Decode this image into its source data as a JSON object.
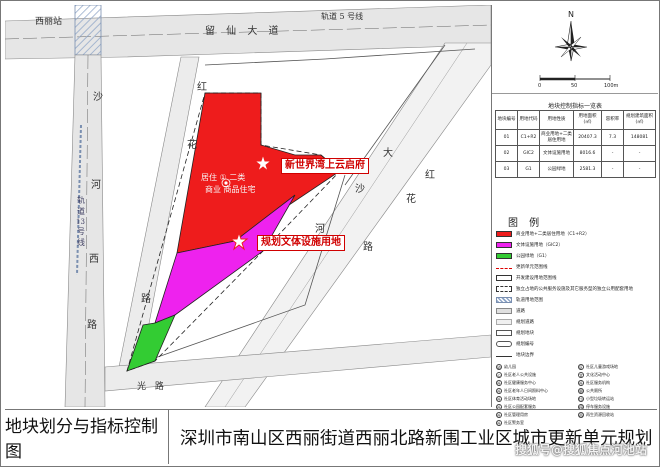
{
  "map": {
    "road_labels": {
      "metro": "轨道 5 号线",
      "liuxian": "留  仙  大  道",
      "xili": "西丽站",
      "honghua": [
        "红",
        "花",
        "路"
      ],
      "shahe": [
        "沙",
        "河",
        "西",
        "路"
      ],
      "metro_v": [
        "轨",
        "道",
        "13",
        "号",
        "线"
      ],
      "dasha_hua": [
        "大",
        "沙",
        "红",
        "花",
        "河",
        "路"
      ],
      "guangming": "光  路"
    },
    "callouts": {
      "hotel": "新世界湾上云启府",
      "culture": "规划文体设施用地"
    },
    "parcel_text": [
      "居住 ①  二类",
      "商业 商品住宅"
    ],
    "colors": {
      "residential": "#ee1c1c",
      "culture": "#ee22ee",
      "park": "#33cc33",
      "road": "#d9d9d9",
      "highlight_star": "#ee1c1c"
    }
  },
  "side": {
    "compass": {
      "north": "N",
      "scale": [
        "0",
        "50",
        "100m"
      ]
    },
    "index_title": "地块控制指标一览表",
    "index_headers": [
      "地块编号",
      "用地代码",
      "用地性质",
      "用地面积(㎡)",
      "容积率",
      "规划建筑面积(㎡)"
    ],
    "index_rows": [
      [
        "01",
        "C1+R2",
        "商业用地+二类居住用地",
        "20407.3",
        "7.3",
        "148081"
      ],
      [
        "02",
        "GIC2",
        "文体设施用地",
        "8016.6",
        "-",
        "-"
      ],
      [
        "03",
        "G1",
        "公园绿地",
        "2581.3",
        "-",
        "-"
      ]
    ],
    "legend_title": "图  例",
    "legend_items": [
      {
        "label": "商业用地+二类居住用地（C1+R2）",
        "color": "#ee1c1c"
      },
      {
        "label": "文体设施用地（GIC2）",
        "color": "#ee22ee"
      },
      {
        "label": "公园绿地（G1）",
        "color": "#33cc33"
      },
      {
        "label": "更新单元范围线",
        "color": ""
      },
      {
        "label": "开发建设用地范围线",
        "color": ""
      },
      {
        "label": "独立占地的公共服务设施及其它服务型的独立公用配套用地",
        "color": ""
      },
      {
        "label": "轨道用地范围",
        "color": ""
      },
      {
        "label": "道路",
        "color": ""
      },
      {
        "label": "规划道路",
        "color": ""
      },
      {
        "label": "规划地块",
        "color": ""
      },
      {
        "label": "规划编号",
        "color": ""
      },
      {
        "label": "地块边界",
        "color": ""
      }
    ],
    "legend_points": [
      {
        "icon": "幼",
        "label": "幼儿园"
      },
      {
        "icon": "区",
        "label": "社区儿童游戏场地"
      },
      {
        "icon": "公",
        "label": "社区老人公共设施"
      },
      {
        "icon": "文",
        "label": "文化活动中心"
      },
      {
        "icon": "社",
        "label": "社区健康服务中心"
      },
      {
        "icon": "社",
        "label": "社区服务机构"
      },
      {
        "icon": "社",
        "label": "社区老年人日间照料中心"
      },
      {
        "icon": "厕",
        "label": "公共厕所"
      },
      {
        "icon": "社",
        "label": "社区体育活动场地"
      },
      {
        "icon": "垃",
        "label": "小型垃圾转运站"
      },
      {
        "icon": "社",
        "label": "社区公园配套服务"
      },
      {
        "icon": "停",
        "label": "停车服务设施"
      },
      {
        "icon": "社",
        "label": "社区管理用房"
      },
      {
        "icon": "再",
        "label": "再生资源回收站"
      },
      {
        "icon": "社",
        "label": "社区警务室"
      }
    ]
  },
  "bottom": {
    "left_title": "地块划分与指标控制图",
    "right_title": "深圳市南山区西丽街道西丽北路新围工业区城市更新单元规划",
    "watermark": "搜狐号@搜狐焦点河池站"
  }
}
